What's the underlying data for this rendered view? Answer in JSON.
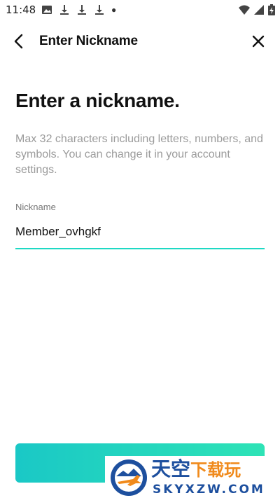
{
  "status_bar": {
    "time": "11:48",
    "icons": [
      "image-icon",
      "download-icon",
      "download-icon",
      "download-icon",
      "dot-icon",
      "wifi-icon",
      "signal-icon",
      "battery-charging-icon"
    ]
  },
  "app_bar": {
    "title": "Enter Nickname",
    "back_icon": "chevron-left-icon",
    "close_icon": "close-icon"
  },
  "main": {
    "heading": "Enter a nickname.",
    "description": "Max 32 characters including letters, numbers, and symbols. You can change it in your account settings.",
    "field_label": "Nickname",
    "nickname_value": "Member_ovhgkf",
    "button_label": ""
  },
  "watermark": {
    "cn_part1": "天空",
    "cn_part2": "下载玩",
    "en": "SKYXZW.COM"
  },
  "colors": {
    "accent": "#1ed9c4",
    "button_start": "#1ac8c6",
    "button_end": "#2ee3b6",
    "description": "#9b9b9b",
    "watermark_blue": "#1d4f9e",
    "watermark_orange": "#f08a1c"
  }
}
